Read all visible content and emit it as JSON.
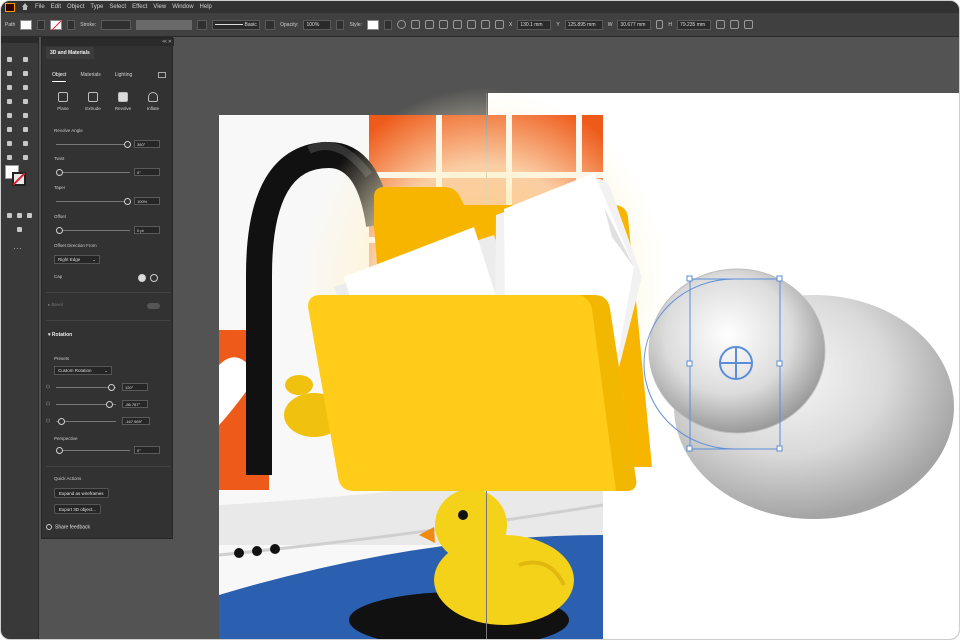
{
  "app": {
    "menu": [
      "File",
      "Edit",
      "Object",
      "Type",
      "Select",
      "Effect",
      "View",
      "Window",
      "Help"
    ]
  },
  "control_bar": {
    "object_label": "Path",
    "stroke_label": "Stroke:",
    "stroke_profile": "Basic",
    "opacity_label": "Opacity:",
    "opacity_value": "100%",
    "style_label": "Style:",
    "x_value": "130.1 mm",
    "y_value": "125.895 mm",
    "w_value": "30.677 mm",
    "h_value": "79.235 mm"
  },
  "panel": {
    "title": "3D and Materials",
    "tabs": [
      "Object",
      "Materials",
      "Lighting"
    ],
    "object_types": [
      "Plane",
      "Extrude",
      "Revolve",
      "Inflate"
    ],
    "active_object_type": "Revolve",
    "revolve_angle": {
      "label": "Revolve Angle",
      "value": "360°"
    },
    "twist": {
      "label": "Twist",
      "value": "0°"
    },
    "taper": {
      "label": "Taper",
      "value": "100%"
    },
    "offset": {
      "label": "Offset",
      "value": "0 pt"
    },
    "offset_direction": {
      "label": "Offset Direction From",
      "value": "Right Edge"
    },
    "cap_label": "Cap",
    "bevel_label": "Bevel",
    "rotation": {
      "section": "Rotation",
      "presets_label": "Presets",
      "preset": "Custom Rotation",
      "x": "120°",
      "y": "-86.787°",
      "z": "-167.969°",
      "perspective_label": "Perspective",
      "perspective": "0°"
    },
    "quick_actions": {
      "label": "Quick Actions",
      "expand": "Expand as wireframes",
      "export": "Export 3D object..."
    },
    "feedback": "Share feedback"
  },
  "colors": {
    "ui_dark": "#323232",
    "canvas": "#535353",
    "folder_back": "#f7b500",
    "folder_front": "#ffcc1a",
    "selection": "#5b8dd9",
    "tile_orange": "#ee5a1a",
    "water_blue": "#2b5fb0",
    "duck_yellow": "#f5d21a"
  },
  "icons": {
    "folder": "folder-open-icon",
    "transform": "transform-center-icon"
  }
}
